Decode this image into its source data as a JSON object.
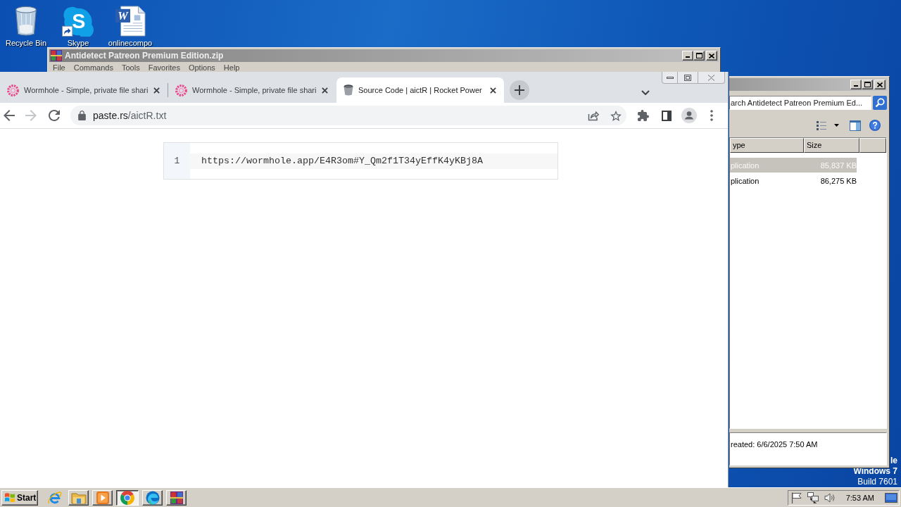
{
  "desktop": {
    "icons": [
      {
        "kind": "recycle-bin",
        "label": "Recycle Bin",
        "shortcut": false
      },
      {
        "kind": "skype",
        "label": "Skype",
        "glyph": "S",
        "shortcut": true
      },
      {
        "kind": "word-document",
        "label": "onlinecompo",
        "glyph": "W",
        "shortcut": false
      }
    ],
    "os_label": [
      {
        "text": "le",
        "bold": true
      },
      {
        "text": "Windows 7",
        "bold": true
      },
      {
        "text": "Build 7601",
        "bold": false
      }
    ]
  },
  "archive_window": {
    "title": "Antidetect Patreon Premium Edition.zip",
    "menu": [
      "File",
      "Commands",
      "Tools",
      "Favorites",
      "Options",
      "Help"
    ]
  },
  "explorer_window": {
    "search": {
      "placeholder": "arch Antidetect Patreon Premium Ed..."
    },
    "columns": [
      "ype",
      "Size"
    ],
    "rows": [
      {
        "type": "plication",
        "size": "85,837 KB",
        "selected": true
      },
      {
        "type": "plication",
        "size": "86,275 KB",
        "selected": false
      }
    ],
    "details": "reated: 6/6/2025 7:50 AM"
  },
  "browser": {
    "tabs": [
      {
        "kind": "wormhole",
        "title": "Wormhole - Simple, private file shari",
        "selected": false
      },
      {
        "kind": "wormhole",
        "title": "Wormhole - Simple, private file shari",
        "selected": false
      },
      {
        "kind": "bucket",
        "title": "Source Code | aictR | Rocket Power",
        "selected": true
      }
    ],
    "nav_buttons": [
      {
        "kind": "back",
        "disabled": false
      },
      {
        "kind": "forward",
        "disabled": true
      },
      {
        "kind": "reload",
        "disabled": false
      }
    ],
    "address": {
      "host": "paste.rs",
      "path": "/aictR.txt"
    },
    "paste": {
      "lines": [
        {
          "number": "1",
          "text": "https://wormhole.app/E4R3om#Y_Qm2f1T34yEffK4yKBj8A"
        }
      ]
    }
  },
  "taskbar": {
    "start": "Start",
    "quick_launch": [
      {
        "kind": "internet-explorer"
      }
    ],
    "tasks": [
      {
        "kind": "file-explorer",
        "active": false
      },
      {
        "kind": "media-player",
        "active": false
      },
      {
        "kind": "chrome",
        "active": true
      },
      {
        "kind": "edge",
        "active": false
      },
      {
        "kind": "winrar",
        "active": false
      }
    ],
    "clock": "7:53 AM"
  }
}
